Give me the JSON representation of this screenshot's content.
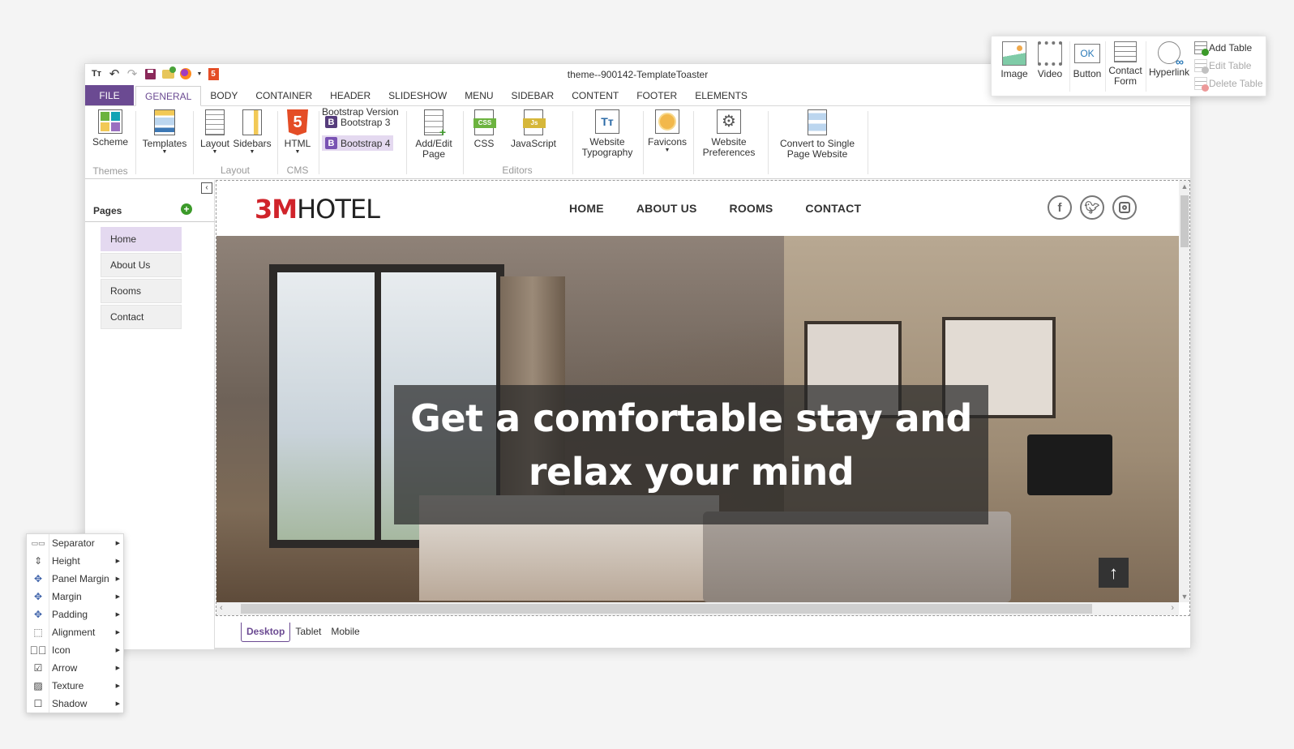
{
  "window": {
    "title": "theme--900142-TemplateToaster",
    "quick_access": [
      "typography-icon",
      "undo-icon",
      "redo-icon",
      "save-icon",
      "open-folder-icon",
      "firefox-preview-icon",
      "html5-export-icon"
    ]
  },
  "tabs": [
    {
      "label": "FILE"
    },
    {
      "label": "GENERAL"
    },
    {
      "label": "BODY"
    },
    {
      "label": "CONTAINER"
    },
    {
      "label": "HEADER"
    },
    {
      "label": "SLIDESHOW"
    },
    {
      "label": "MENU"
    },
    {
      "label": "SIDEBAR"
    },
    {
      "label": "CONTENT"
    },
    {
      "label": "FOOTER"
    },
    {
      "label": "ELEMENTS"
    }
  ],
  "ribbon": {
    "scheme": "Scheme",
    "templates": "Templates",
    "layout": "Layout",
    "sidebars": "Sidebars",
    "html": "HTML",
    "bootstrap3": "Bootstrap 3",
    "bootstrap4": "Bootstrap 4",
    "add_edit_page_1": "Add/Edit",
    "add_edit_page_2": "Page",
    "css": "CSS",
    "javascript": "JavaScript",
    "website_typography_1": "Website",
    "website_typography_2": "Typography",
    "favicons": "Favicons",
    "website_prefs_1": "Website",
    "website_prefs_2": "Preferences",
    "convert_1": "Convert to Single",
    "convert_2": "Page Website",
    "groups": {
      "themes": "Themes",
      "layout": "Layout",
      "cms": "CMS",
      "bootstrap": "Bootstrap Version",
      "editors": "Editors"
    },
    "colors": {
      "accent": "#6b4a92",
      "bootstrap_selected_bg": "#e4d9f0"
    }
  },
  "pages_panel": {
    "title": "Pages",
    "items": [
      {
        "label": "Home",
        "selected": true
      },
      {
        "label": "About Us"
      },
      {
        "label": "Rooms"
      },
      {
        "label": "Contact"
      }
    ]
  },
  "site": {
    "logo_bold": "3M",
    "logo_rest": "HOTEL",
    "nav": [
      "HOME",
      "ABOUT US",
      "ROOMS",
      "CONTACT"
    ],
    "social": [
      "facebook",
      "twitter",
      "instagram"
    ],
    "hero_line1": "Get a comfortable stay and",
    "hero_line2": "relax your mind",
    "brand_color": "#d0232a"
  },
  "device_tabs": [
    {
      "label": "Desktop",
      "selected": true
    },
    {
      "label": "Tablet"
    },
    {
      "label": "Mobile"
    }
  ],
  "palette": {
    "image": "Image",
    "video": "Video",
    "button": "Button",
    "button_glyph": "OK",
    "contact_1": "Contact",
    "contact_2": "Form",
    "hyperlink": "Hyperlink",
    "add_table": "Add Table",
    "edit_table": "Edit Table",
    "delete_table": "Delete Table"
  },
  "context_menu": [
    {
      "label": "Separator",
      "icon": "separator-icon"
    },
    {
      "label": "Height",
      "icon": "height-icon"
    },
    {
      "label": "Panel Margin",
      "icon": "panel-margin-icon"
    },
    {
      "label": "Margin",
      "icon": "margin-icon"
    },
    {
      "label": "Padding",
      "icon": "padding-icon"
    },
    {
      "label": "Alignment",
      "icon": "alignment-icon"
    },
    {
      "label": "Icon",
      "icon": "check-circle-icon"
    },
    {
      "label": "Arrow",
      "icon": "arrow-box-icon"
    },
    {
      "label": "Texture",
      "icon": "texture-icon"
    },
    {
      "label": "Shadow",
      "icon": "shadow-icon"
    }
  ]
}
